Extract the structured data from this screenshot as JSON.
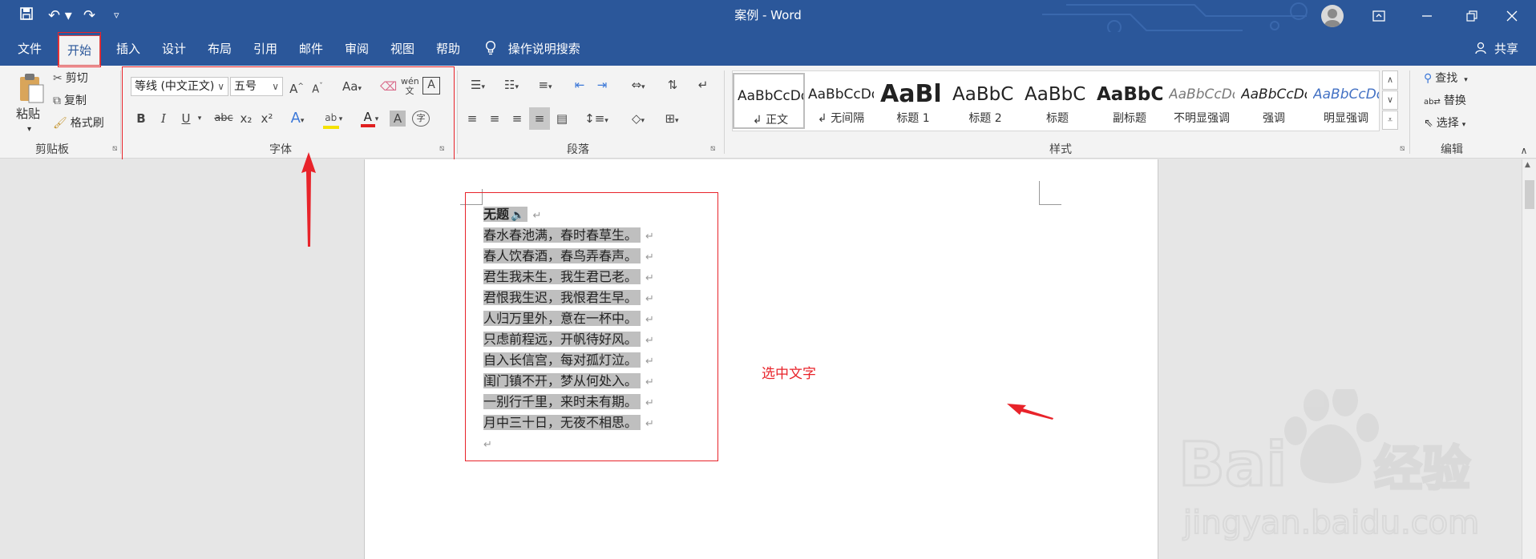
{
  "titlebar": {
    "title": "案例 - Word"
  },
  "menu": {
    "tabs": [
      "文件",
      "开始",
      "插入",
      "设计",
      "布局",
      "引用",
      "邮件",
      "审阅",
      "视图",
      "帮助"
    ],
    "active_tab": "开始",
    "tell_me": "操作说明搜索",
    "share": "共享"
  },
  "ribbon": {
    "clipboard": {
      "paste": "粘贴",
      "cut": "剪切",
      "copy": "复制",
      "format_painter": "格式刷",
      "label": "剪贴板"
    },
    "font": {
      "font_name": "等线 (中文正文)",
      "font_size": "五号",
      "change_case": "Aa",
      "bold": "B",
      "italic": "I",
      "underline": "U",
      "strikethrough": "abc",
      "subscript": "x₂",
      "superscript": "x²",
      "label": "字体"
    },
    "paragraph": {
      "label": "段落"
    },
    "styles": {
      "label": "样式",
      "items": [
        {
          "preview": "AaBbCcDd",
          "name": "正文"
        },
        {
          "preview": "AaBbCcDd",
          "name": "无间隔"
        },
        {
          "preview": "AaBl",
          "name": "标题 1"
        },
        {
          "preview": "AaBbC",
          "name": "标题 2"
        },
        {
          "preview": "AaBbC",
          "name": "标题"
        },
        {
          "preview": "AaBbC",
          "name": "副标题"
        },
        {
          "preview": "AaBbCcDd",
          "name": "不明显强调"
        },
        {
          "preview": "AaBbCcDd",
          "name": "强调"
        },
        {
          "preview": "AaBbCcDd",
          "name": "明显强调"
        }
      ]
    },
    "editing": {
      "find": "查找",
      "replace": "替换",
      "select": "选择",
      "label": "编辑"
    }
  },
  "document": {
    "title": "无题",
    "lines": [
      "春水春池满，春时春草生。",
      "春人饮春酒，春鸟弄春声。",
      "君生我未生，我生君已老。",
      "君恨我生迟，我恨君生早。",
      "人归万里外，意在一杯中。",
      "只虑前程远，开帆待好风。",
      "自入长信宫，每对孤灯泣。",
      "闺门镇不开，梦从何处入。",
      "一别行千里，来时未有期。",
      "月中三十日，无夜不相思。"
    ],
    "paragraph_mark": "↵"
  },
  "annotation": {
    "text": "选中文字"
  },
  "watermark": {
    "brand": "Baidu经验",
    "url": "jingyan.baidu.com"
  },
  "colors": {
    "titlebar": "#2b579a",
    "annotation": "#e8232a",
    "selection": "#bfbfbf"
  }
}
